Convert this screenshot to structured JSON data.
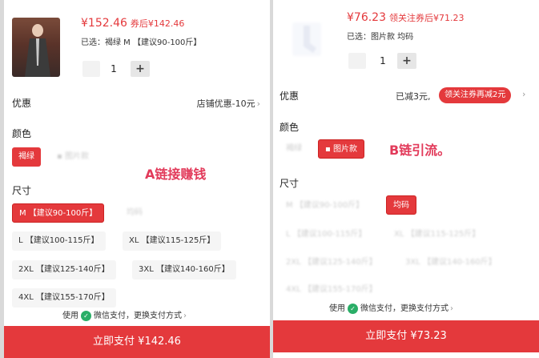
{
  "panel_a": {
    "price": "¥152.46",
    "price_after": "券后¥142.46",
    "selected_label": "已选：褐绿 M 【建议90-100斤】",
    "qty": "1",
    "plus": "+",
    "promo_label": "优惠",
    "promo_value": "店铺优惠-10元",
    "chevron": "›",
    "color_label": "颜色",
    "colors": [
      "褐绿",
      "图片款"
    ],
    "annotation": "A链接赚钱",
    "size_label": "尺寸",
    "sizes": [
      "M 【建议90-100斤】",
      "均码",
      "L 【建议100-115斤】",
      "XL 【建议115-125斤】",
      "2XL 【建议125-140斤】",
      "3XL 【建议140-160斤】",
      "4XL 【建议155-170斤】"
    ],
    "pay_prefix": "使用",
    "pay_method": "微信支付，更换支付方式",
    "pay_button": "立即支付 ¥142.46"
  },
  "panel_b": {
    "price": "¥76.23",
    "price_after": "领关注券后¥71.23",
    "selected_label": "已选：图片款 均码",
    "qty": "1",
    "plus": "+",
    "promo_label": "优惠",
    "promo_value": "已减3元,",
    "coupon_button": "领关注券再减2元",
    "chevron": "›",
    "color_label": "颜色",
    "colors": [
      "褐绿",
      "图片款"
    ],
    "annotation": "B链引流。",
    "size_label": "尺寸",
    "sizes": [
      "M 【建议90-100斤】",
      "均码",
      "L 【建议100-115斤】",
      "XL 【建议115-125斤】",
      "2XL 【建议125-140斤】",
      "3XL 【建议140-160斤】",
      "4XL 【建议155-170斤】"
    ],
    "pay_prefix": "使用",
    "pay_method": "微信支付，更换支付方式",
    "pay_button": "立即支付 ¥73.23"
  },
  "colors": {
    "accent": "#e4393c",
    "wechat": "#2aae67",
    "annotation": "#e23a5a"
  }
}
